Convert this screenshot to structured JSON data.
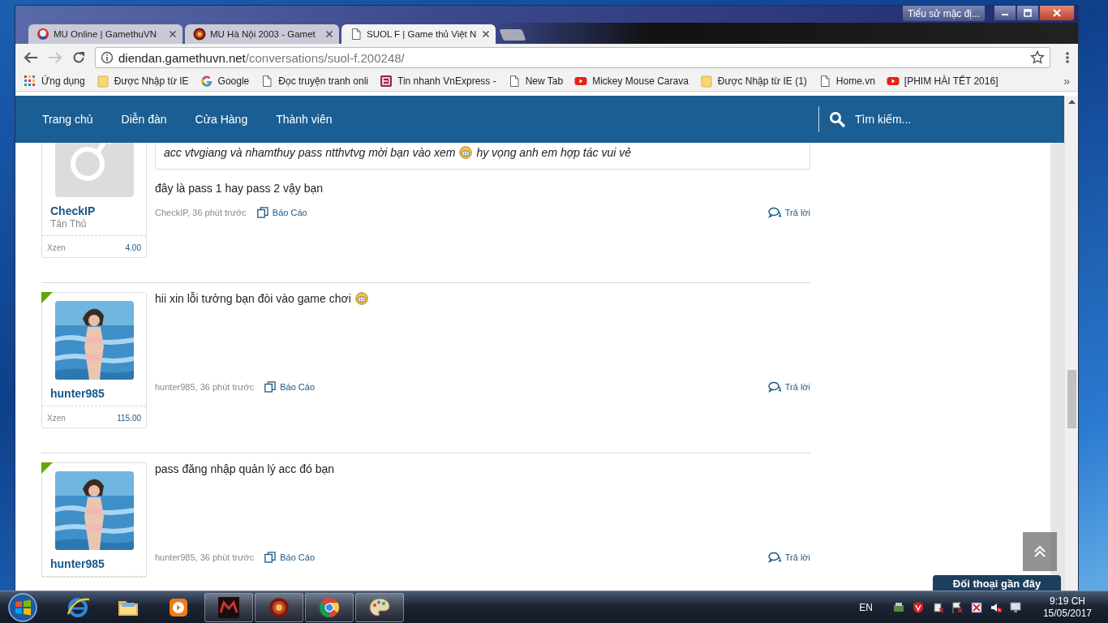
{
  "window": {
    "profile_button": "Tiểu sử mặc đị...",
    "tabs": [
      {
        "title": "MU Online | GamethuVN",
        "kind": "mu",
        "selected": false
      },
      {
        "title": "MU Hà Nội 2003 - Gamet",
        "kind": "mu2",
        "selected": false
      },
      {
        "title": "SUOL F | Game thủ Việt N",
        "kind": "page",
        "selected": true
      }
    ]
  },
  "toolbar": {
    "url_host": "diendan.gamethuvn.net",
    "url_path": "/conversations/suol-f.200248/",
    "more_bookmarks": "»"
  },
  "bookmarks": [
    {
      "label": "Ứng dụng",
      "kind": "apps"
    },
    {
      "label": "Được Nhập từ IE",
      "kind": "folder"
    },
    {
      "label": "Google",
      "kind": "google"
    },
    {
      "label": "Đọc truyện tranh onli",
      "kind": "page"
    },
    {
      "label": "Tin nhanh VnExpress -",
      "kind": "vnexpress"
    },
    {
      "label": "New Tab",
      "kind": "page"
    },
    {
      "label": "Mickey Mouse Carava",
      "kind": "youtube"
    },
    {
      "label": "Được Nhập từ IE (1)",
      "kind": "folder"
    },
    {
      "label": "Home.vn",
      "kind": "page"
    },
    {
      "label": "[PHIM HÀI TẾT 2016]",
      "kind": "youtube"
    }
  ],
  "nav": {
    "items": [
      "Trang chủ",
      "Diễn đàn",
      "Cửa Hàng",
      "Thành viên"
    ],
    "search_placeholder": "Tìm kiếm..."
  },
  "posts": [
    {
      "author": "CheckIP",
      "user_title": "Tân Thủ",
      "kind": "default-avatar",
      "online": false,
      "points_label": "Xzen",
      "points": "4.00",
      "quote": [
        {
          "kind": "text",
          "text": "acc vtvgiang và nhamthuy pass ntthvtvg mời bạn vào xem"
        },
        {
          "kind": "emoji"
        },
        {
          "kind": "text",
          "text": "hy vọng anh em hợp tác vui vẻ"
        }
      ],
      "message": [
        {
          "kind": "text",
          "text": "đây là pass 1 hay pass 2 vậy bạn"
        }
      ],
      "meta": "CheckIP, 36 phút trước",
      "report": "Báo Cáo",
      "reply": "Trả lời"
    },
    {
      "author": "hunter985",
      "kind": "photo-avatar",
      "online": true,
      "points_label": "Xzen",
      "points": "115.00",
      "message": [
        {
          "kind": "text",
          "text": "hii xin lỗi tưởng bạn đòi vào game chơi"
        },
        {
          "kind": "emoji"
        }
      ],
      "meta": "hunter985, 36 phút trước",
      "report": "Báo Cáo",
      "reply": "Trả lời"
    },
    {
      "author": "hunter985",
      "kind": "photo-avatar",
      "online": true,
      "message": [
        {
          "kind": "text",
          "text": "pass đăng nhập quản lý acc đó bạn"
        }
      ],
      "meta": "hunter985, 36 phút trước",
      "report": "Báo Cáo",
      "reply": "Trả lời"
    }
  ],
  "recent_conversations": "Đối thoại gần đây",
  "taskbar": {
    "apps": [
      {
        "kind": "ie",
        "open": false
      },
      {
        "kind": "folder",
        "open": false
      },
      {
        "kind": "media",
        "open": false
      },
      {
        "kind": "mu",
        "open": true
      },
      {
        "kind": "mu2",
        "open": true
      },
      {
        "kind": "chrome",
        "open": true
      },
      {
        "kind": "paint",
        "open": true
      }
    ],
    "language": "EN",
    "time": "9:19 CH",
    "date": "15/05/2017"
  }
}
